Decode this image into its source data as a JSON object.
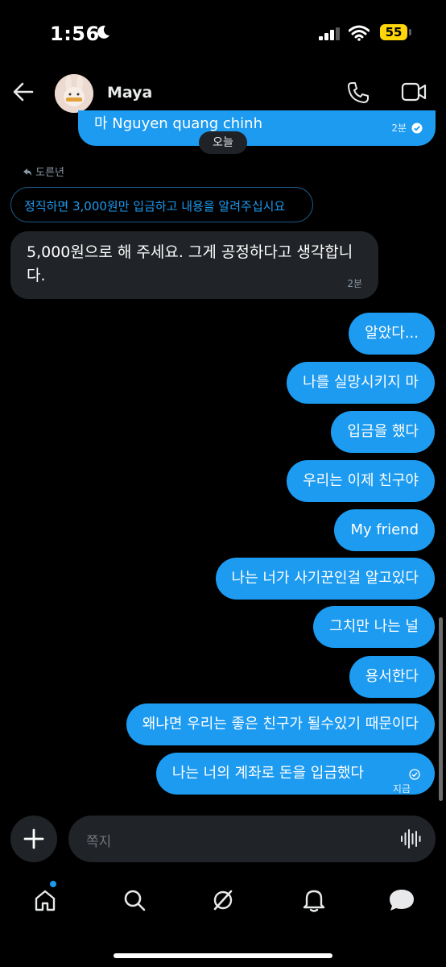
{
  "status_bar": {
    "time": "1:56",
    "battery": "55"
  },
  "header": {
    "contact_name": "Maya"
  },
  "conversation": {
    "previous_message": {
      "text": "마 Nguyen quang chinh",
      "time": "2분"
    },
    "date_separator": "오늘",
    "reply_label": "도른년",
    "quoted_text": "정직하면 3,000원만 입금하고 내용을 알려주십시요",
    "incoming": {
      "text": "5,000원으로 해 주세요. 그게 공정하다고 생각합니다.",
      "time": "2분"
    },
    "outgoing": [
      {
        "text": "알았다..."
      },
      {
        "text": "나를 실망시키지 마"
      },
      {
        "text": "입금을 했다"
      },
      {
        "text": "우리는 이제 친구야"
      },
      {
        "text": "My friend"
      },
      {
        "text": "나는 너가 사기꾼인걸 알고있다"
      },
      {
        "text": "그치만 나는 널"
      },
      {
        "text": "용서한다"
      },
      {
        "text": "왜냐면 우리는 좋은 친구가 될수있기 때문이다"
      },
      {
        "text": "나는 너의 계좌로 돈을 입금했다",
        "time": "지금"
      }
    ]
  },
  "composer": {
    "placeholder": "쪽지"
  },
  "tab_bar": {
    "items": [
      "home-icon",
      "search-icon",
      "grok-icon",
      "notifications-icon",
      "messages-icon"
    ]
  },
  "colors": {
    "accent": "#1d9bf0",
    "incoming_bubble": "#202327",
    "background": "#000000"
  }
}
